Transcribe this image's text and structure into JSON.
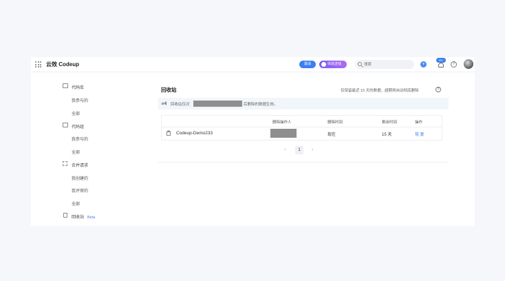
{
  "topbar": {
    "brand": "云效 Codeup",
    "invite_label": "邀请",
    "experience_label": "体验送钱",
    "search_placeholder": "搜索",
    "plus_label": "+",
    "notification_badge": "99+",
    "help_label": "?"
  },
  "sidebar": {
    "sections": [
      {
        "label": "代码库",
        "icon": "repository-icon",
        "items": [
          "我参与的",
          "全部"
        ]
      },
      {
        "label": "代码组",
        "icon": "group-icon",
        "items": [
          "我参与的",
          "全部"
        ]
      },
      {
        "label": "合并请求",
        "icon": "merge-request-icon",
        "items": [
          "我创建的",
          "我评审的",
          "全部"
        ]
      }
    ],
    "recycle": {
      "label": "回收站",
      "badge": "Beta",
      "icon": "trash-icon"
    }
  },
  "main": {
    "title": "回收站",
    "retention_notice": "仅保留最近 15 天的数据，超期将自动彻底删除",
    "help_label": "?",
    "notice_prefix": "回收站仅对",
    "notice_suffix": "后删除的数据生效。",
    "table": {
      "headers": [
        "删除操作人",
        "删除时间",
        "剩余时间",
        "操作"
      ],
      "rows": [
        {
          "name": "Codeup-Demo233",
          "deleted_at": "现在",
          "remaining": "15 天",
          "action": "恢复"
        }
      ]
    },
    "pagination": {
      "prev": "‹",
      "current": "1",
      "next": "›"
    }
  },
  "colors": {
    "accent": "#3d7ff3",
    "page_bg": "#f5f7fb",
    "notice_bg": "#f1f6fb",
    "redaction": "#8f8f8f"
  }
}
